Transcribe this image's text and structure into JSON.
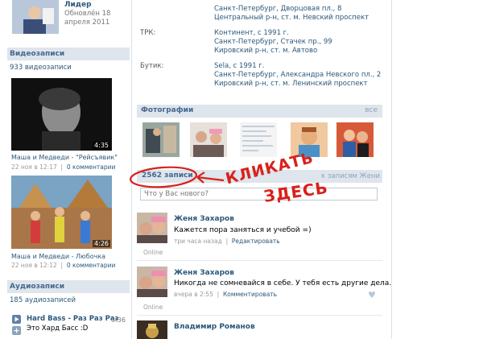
{
  "profile_card": {
    "title": "Лидер",
    "updated_line1": "Обновлён 18",
    "updated_line2": "апреля 2011"
  },
  "videos": {
    "header": "Видеозаписи",
    "count": "933 видеозаписи",
    "items": [
      {
        "duration": "4:35",
        "title": "Маша и Медведи - \"Рейсъявик\"",
        "date": "22 ноя в 12:17",
        "comments": "0 комментарии"
      },
      {
        "duration": "4:26",
        "title": "Маша и Медведи - Любочка",
        "date": "22 ноя в 12:12",
        "comments": "0 комментарии"
      }
    ]
  },
  "audio": {
    "header": "Аудиозаписи",
    "count": "185 аудиозаписей",
    "items": [
      {
        "title": "Hard Bass - Раз Раз Раз",
        "subtitle": "Это Хард Басс :D",
        "duration": "3:36"
      }
    ]
  },
  "info": {
    "rows": [
      {
        "label": "",
        "lines": [
          "Санкт-Петербург, Дворцовая пл., 8",
          "Центральный р-н, ст. м. Невский проспект"
        ]
      },
      {
        "label": "ТРК:",
        "lines": [
          "Континент, с 1991 г.",
          "Санкт-Петербург, Стачек пр., 99",
          "Кировский р-н, ст. м. Автово"
        ]
      },
      {
        "label": "Бутик:",
        "lines": [
          "Sela, с 1991 г.",
          "Санкт-Петербург, Александра Невского пл., 2",
          "Кировский р-н, ст. м. Ленинский проспект"
        ]
      }
    ]
  },
  "photos": {
    "header": "Фотографии",
    "all_link": "все"
  },
  "wall": {
    "count": "2562 записи",
    "to_link": "к записям Жени",
    "input_placeholder": "Что у Вас нового?",
    "annotation_line1": "КЛИКАТЬ",
    "annotation_line2": "ЗДЕСЬ",
    "posts": [
      {
        "author": "Женя Захаров",
        "text": "Кажется пора заняться и учебой =)",
        "time": "три часа назад",
        "action": "Редактировать",
        "status": "Online"
      },
      {
        "author": "Женя Захаров",
        "text": "Никогда не сомневайся в себе. У тебя есть другие дела.",
        "time": "вчера в 2:55",
        "action": "Комментировать",
        "status": "Online"
      },
      {
        "author": "Владимир Романов",
        "text": "",
        "time": "",
        "action": "",
        "status": ""
      }
    ]
  },
  "colors": {
    "link": "#2b587a",
    "header_bg": "#dee5ec",
    "annotation_red": "#d9211a"
  }
}
